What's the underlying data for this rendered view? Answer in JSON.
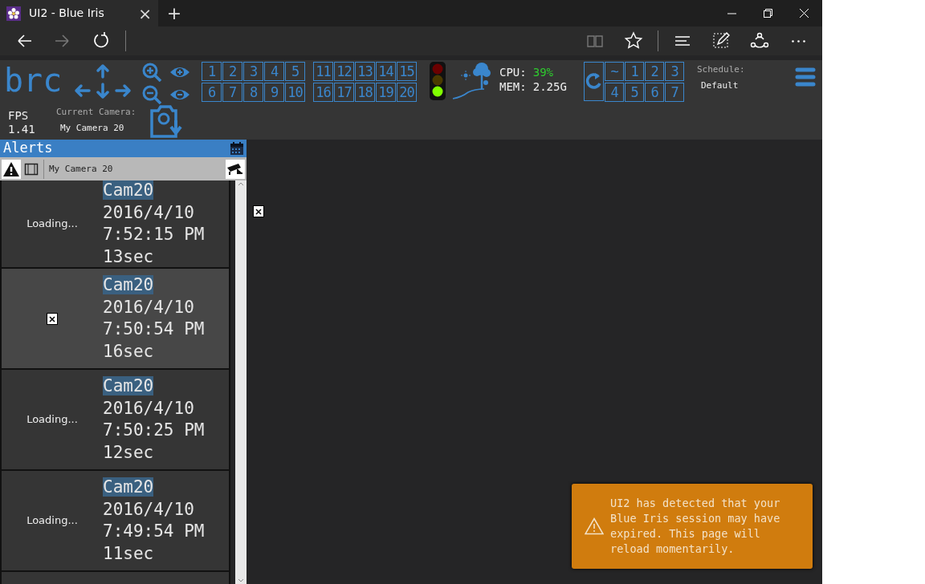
{
  "browser": {
    "tab_title": "UI2 - Blue Iris",
    "tab_close": "×",
    "new_tab": "+"
  },
  "header": {
    "logo": "brc",
    "fps_label": "FPS",
    "fps_value": "1.41",
    "current_camera_label": "Current Camera:",
    "current_camera": "My Camera 20",
    "camera_buttons_a": [
      "1",
      "2",
      "3",
      "4",
      "5",
      "6",
      "7",
      "8",
      "9",
      "10"
    ],
    "camera_buttons_b": [
      "11",
      "12",
      "13",
      "14",
      "15",
      "16",
      "17",
      "18",
      "19",
      "20"
    ],
    "status_lights": [
      {
        "on": false
      },
      {
        "on": false
      },
      {
        "on": true
      }
    ],
    "cpu_label": "CPU:",
    "cpu_value": "39%",
    "mem_label": "MEM:",
    "mem_value": "2.25G",
    "profile_buttons": [
      "~",
      "1",
      "2",
      "3",
      "4",
      "5",
      "6",
      "7"
    ],
    "schedule_label": "Schedule:",
    "schedule_value": "Default"
  },
  "alerts": {
    "title": "Alerts",
    "camera_filter": "My Camera 20",
    "items": [
      {
        "kind": "loading",
        "thumbnail_text": "Loading...",
        "camera": "Cam20",
        "date": "2016/4/10",
        "time": "7:52:15 PM",
        "duration": "13sec",
        "selected": false
      },
      {
        "kind": "broken_image",
        "camera": "Cam20",
        "date": "2016/4/10",
        "time": "7:50:54 PM",
        "duration": "16sec",
        "selected": true
      },
      {
        "kind": "loading",
        "thumbnail_text": "Loading...",
        "camera": "Cam20",
        "date": "2016/4/10",
        "time": "7:50:25 PM",
        "duration": "12sec",
        "selected": false
      },
      {
        "kind": "loading",
        "thumbnail_text": "Loading...",
        "camera": "Cam20",
        "date": "2016/4/10",
        "time": "7:49:54 PM",
        "duration": "11sec",
        "selected": false
      }
    ]
  },
  "toast": {
    "message": "UI2 has detected that your Blue Iris session may have expired. This page will reload momentarily."
  }
}
